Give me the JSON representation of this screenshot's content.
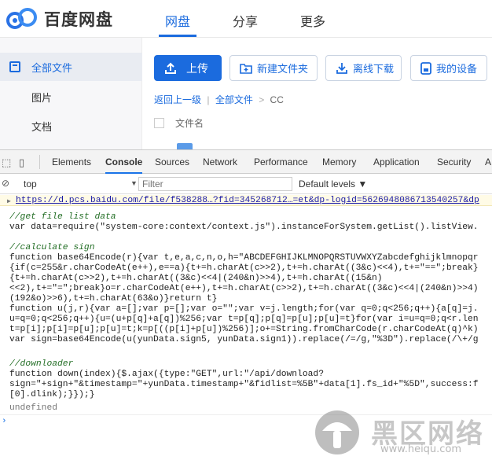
{
  "app": {
    "brand": "百度网盘",
    "nav": [
      "网盘",
      "分享",
      "更多"
    ]
  },
  "sidebar": {
    "items": [
      {
        "label": "全部文件"
      },
      {
        "label": "图片"
      },
      {
        "label": "文档"
      }
    ]
  },
  "toolbar": {
    "upload": "上传",
    "new_folder": "新建文件夹",
    "offline": "离线下载",
    "devices": "我的设备"
  },
  "breadcrumb": {
    "back": "返回上一级",
    "sep": "|",
    "all": "全部文件",
    "chev": ">",
    "current": "CC"
  },
  "list": {
    "col_name": "文件名"
  },
  "devtools": {
    "tabs": [
      "Elements",
      "Console",
      "Sources",
      "Network",
      "Performance",
      "Memory",
      "Application",
      "Security",
      "A"
    ],
    "context": "top",
    "filter_placeholder": "Filter",
    "levels": "Default levels ▼",
    "url_line": "https://d.pcs.baidu.com/file/f538288…?fid=345268712…=et&dp-logid=5626948086713540257&dp",
    "console_lines": [
      "//get file list data",
      "var data=require(\"system-core:context/context.js\").instanceForSystem.getList().listView.",
      "",
      "//calculate sign",
      "function base64Encode(r){var t,e,a,c,n,o,h=\"ABCDEFGHIJKLMNOPQRSTUVWXYZabcdefghijklmnopqr",
      "{if(c=255&r.charCodeAt(e++),e==a){t+=h.charAt(c>>2),t+=h.charAt((3&c)<<4),t+=\"==\";break}",
      "{t+=h.charAt(c>>2),t+=h.charAt((3&c)<<4|(240&n)>>4),t+=h.charAt((15&n)",
      "<<2),t+=\"=\";break}o=r.charCodeAt(e++),t+=h.charAt(c>>2),t+=h.charAt((3&c)<<4|(240&n)>>4)",
      "(192&o)>>6),t+=h.charAt(63&o)}return t}",
      "function u(j,r){var a=[];var p=[];var o=\"\";var v=j.length;for(var q=0;q<256;q++){a[q]=j.",
      "u=q=0;q<256;q++){u=(u+p[q]+a[q])%256;var t=p[q];p[q]=p[u];p[u]=t}for(var i=u=q=0;q<r.len",
      "t=p[i];p[i]=p[u];p[u]=t;k=p[((p[i]+p[u])%256)];o+=String.fromCharCode(r.charCodeAt(q)^k)",
      "var sign=base64Encode(u(yunData.sign5, yunData.sign1)).replace(/=/g,\"%3D\").replace(/\\+/g",
      "",
      "//downloader",
      "function down(index){$.ajax({type:\"GET\",url:\"/api/download?",
      "sign=\"+sign+\"&timestamp=\"+yunData.timestamp+\"&fidlist=%5B\"+data[1].fs_id+\"%5D\",success:f",
      "[0].dlink);}});}",
      "undefined"
    ]
  },
  "watermark": {
    "text": "黑区网络",
    "url": "www.heiqu.com"
  },
  "colors": {
    "accent": "#1b6bde",
    "comment": "#236e25",
    "string": "#c41a16",
    "keyword": "#881280"
  }
}
